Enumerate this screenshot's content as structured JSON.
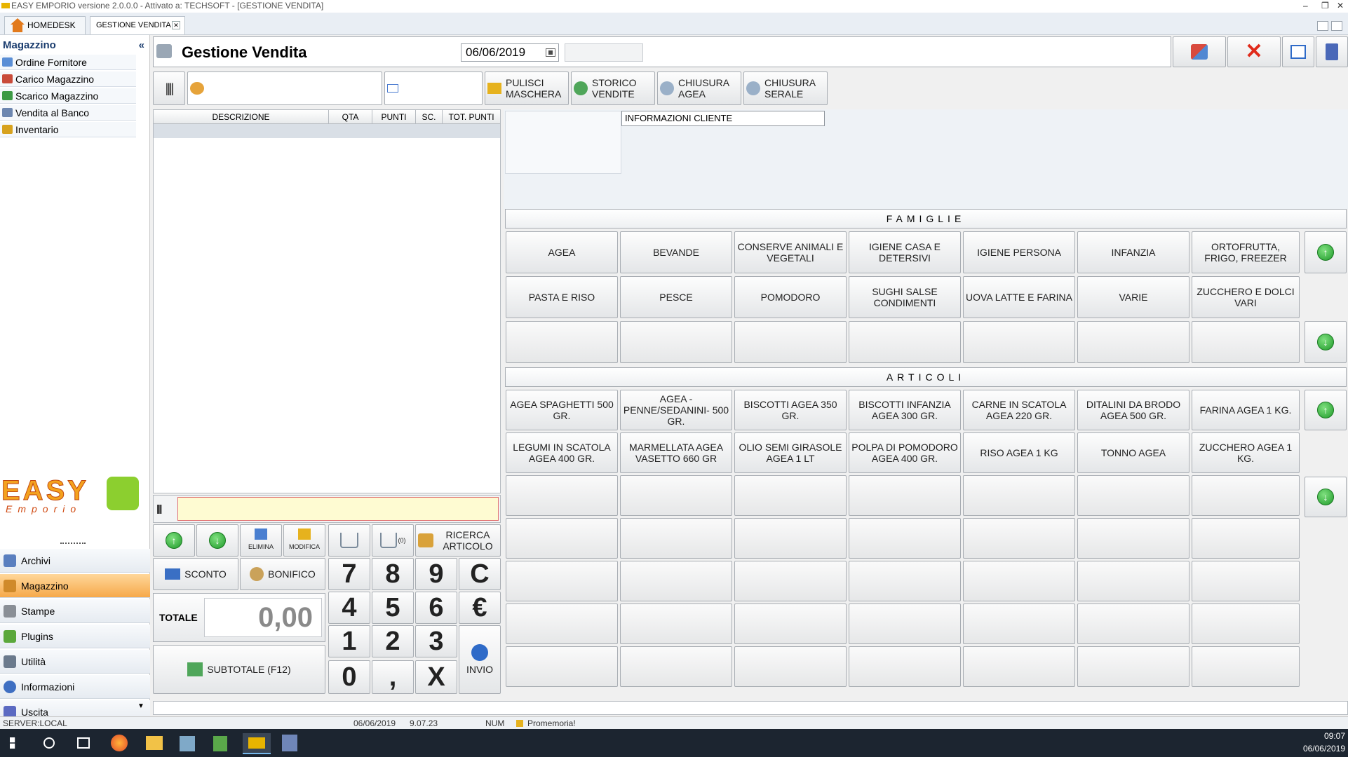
{
  "window": {
    "title": "EASY EMPORIO versione 2.0.0.0 - Attivato a: TECHSOFT - [GESTIONE VENDITA]"
  },
  "tabs": [
    {
      "label": "HOMEDESK"
    },
    {
      "label": "GESTIONE VENDITA"
    }
  ],
  "sidebar": {
    "title": "Magazzino",
    "collapse": "«",
    "items": [
      {
        "label": "Ordine Fornitore"
      },
      {
        "label": "Carico Magazzino"
      },
      {
        "label": "Scarico Magazzino"
      },
      {
        "label": "Vendita al Banco"
      },
      {
        "label": "Inventario"
      }
    ],
    "logo_text": "EASY",
    "logo_sub": "Emporio",
    "nav": [
      {
        "label": "Archivi"
      },
      {
        "label": "Magazzino"
      },
      {
        "label": "Stampe"
      },
      {
        "label": "Plugins"
      },
      {
        "label": "Utilità"
      },
      {
        "label": "Informazioni"
      },
      {
        "label": "Uscita"
      }
    ]
  },
  "header": {
    "title": "Gestione Vendita",
    "date": "06/06/2019"
  },
  "toolbar": {
    "pulisci": "PULISCI MASCHERA",
    "storico": "STORICO VENDITE",
    "chiusura_agea": "CHIUSURA AGEA",
    "chiusura_serale": "CHIUSURA SERALE"
  },
  "table": {
    "columns": [
      "DESCRIZIONE",
      "QTA",
      "PUNTI",
      "SC.",
      "TOT. PUNTI"
    ]
  },
  "client": {
    "label": "INFORMAZIONI CLIENTE"
  },
  "famiglie": {
    "title": "FAMIGLIE",
    "rows": [
      [
        "AGEA",
        "BEVANDE",
        "CONSERVE ANIMALI E VEGETALI",
        "IGIENE CASA E DETERSIVI",
        "IGIENE PERSONA",
        "INFANZIA",
        "ORTOFRUTTA, FRIGO, FREEZER"
      ],
      [
        "PASTA E RISO",
        "PESCE",
        "POMODORO",
        "SUGHI SALSE CONDIMENTI",
        "UOVA LATTE E FARINA",
        "VARIE",
        "ZUCCHERO E DOLCI VARI"
      ],
      [
        "",
        "",
        "",
        "",
        "",
        "",
        ""
      ]
    ]
  },
  "articoli": {
    "title": "ARTICOLI",
    "rows": [
      [
        "AGEA SPAGHETTI 500 GR.",
        "AGEA - PENNE/SEDANINI- 500 GR.",
        "BISCOTTI AGEA 350 GR.",
        "BISCOTTI INFANZIA AGEA 300 GR.",
        "CARNE IN SCATOLA AGEA 220 GR.",
        "DITALINI DA BRODO AGEA 500 GR.",
        "FARINA AGEA 1 KG."
      ],
      [
        "LEGUMI IN SCATOLA AGEA 400 GR.",
        "MARMELLATA AGEA VASETTO 660 GR",
        "OLIO SEMI GIRASOLE AGEA 1 LT",
        "POLPA DI POMODORO AGEA 400 GR.",
        "RISO AGEA 1 KG",
        "TONNO AGEA",
        "ZUCCHERO AGEA 1 KG."
      ],
      [
        "",
        "",
        "",
        "",
        "",
        "",
        ""
      ],
      [
        "",
        "",
        "",
        "",
        "",
        "",
        ""
      ],
      [
        "",
        "",
        "",
        "",
        "",
        "",
        ""
      ],
      [
        "",
        "",
        "",
        "",
        "",
        "",
        ""
      ],
      [
        "",
        "",
        "",
        "",
        "",
        "",
        ""
      ]
    ]
  },
  "pos": {
    "elimina": "ELIMINA",
    "modifica": "MODIFICA",
    "cart_count": "(0)",
    "ricerca": "RICERCA ARTICOLO",
    "sconto": "SCONTO",
    "bonifico": "BONIFICO",
    "totale_label": "TOTALE",
    "totale_value": "0,00",
    "subtotale": "SUBTOTALE (F12)",
    "invio": "INVIO",
    "keys": [
      "7",
      "8",
      "9",
      "C",
      "4",
      "5",
      "6",
      "€",
      "1",
      "2",
      "3",
      "0",
      ",",
      "X"
    ]
  },
  "status": {
    "server": "SERVER:LOCAL",
    "date": "06/06/2019",
    "time": "9.07.23",
    "num": "NUM",
    "promemoria": "Promemoria!"
  },
  "taskbar": {
    "time": "09:07",
    "date": "06/06/2019"
  }
}
